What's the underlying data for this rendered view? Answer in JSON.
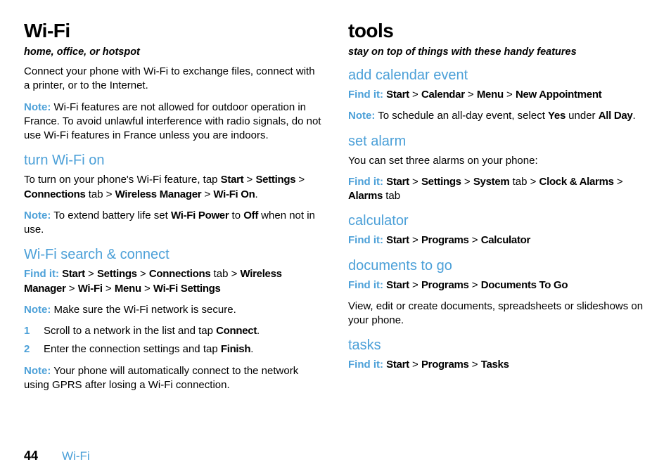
{
  "left": {
    "title": "Wi-Fi",
    "tagline": "home, office, or hotspot",
    "intro": "Connect your phone with Wi-Fi to exchange files, connect with a printer, or to the Internet.",
    "note1_label": "Note:",
    "note1_text": " Wi-Fi features are not allowed for outdoor operation in France. To avoid unlawful interference with radio signals, do not use Wi-Fi features in France unless you are indoors.",
    "s1": {
      "heading": "turn Wi-Fi on",
      "p_pre": "To turn on your phone's Wi-Fi feature, tap ",
      "pth1": "Start",
      "gt1": " > ",
      "pth2": "Settings",
      "gt2": " > ",
      "pth3": "Connections",
      "tab1": " tab > ",
      "pth4": "Wireless Manager",
      "gt3": " > ",
      "pth5": "Wi-Fi On",
      "dot1": ".",
      "note_label": "Note:",
      "note_pre": " To extend battery life set ",
      "note_b1": "Wi-Fi Power",
      "note_mid": " to ",
      "note_b2": "Off",
      "note_post": " when not in use."
    },
    "s2": {
      "heading": "Wi-Fi search & connect",
      "find_label": "Find it:",
      "sp": " ",
      "p1": "Start",
      "g1": " > ",
      "p2": "Settings",
      "g2": " > ",
      "p3": "Connections",
      "t1": " tab > ",
      "p4": "Wireless Manager",
      "g3": " > ",
      "p5": "Wi-Fi",
      "g4": " > ",
      "p6": "Menu",
      "g5": " > ",
      "p7": "Wi-Fi Settings",
      "note_label": "Note:",
      "note_text": " Make sure the Wi-Fi network is secure.",
      "step1_num": "1",
      "step1_pre": "Scroll to a network in the list and tap ",
      "step1_b": "Connect",
      "step1_post": ".",
      "step2_num": "2",
      "step2_pre": "Enter the connection settings and tap ",
      "step2_b": "Finish",
      "step2_post": ".",
      "note2_label": "Note:",
      "note2_text": " Your phone will automatically connect to the network using GPRS after losing a Wi-Fi connection."
    }
  },
  "right": {
    "title": "tools",
    "tagline": "stay on top of things with these handy features",
    "s1": {
      "heading": "add calendar event",
      "find_label": "Find it:",
      "sp": " ",
      "p1": "Start",
      "g1": " > ",
      "p2": "Calendar",
      "g2": " > ",
      "p3": "Menu",
      "g3": " > ",
      "p4": "New Appointment",
      "note_label": "Note:",
      "note_pre": " To schedule an all-day event, select ",
      "note_b1": "Yes",
      "note_mid": " under ",
      "note_b2": "All Day",
      "note_post": "."
    },
    "s2": {
      "heading": "set alarm",
      "intro": "You can set three alarms on your phone:",
      "find_label": "Find it:",
      "sp": "  ",
      "p1": "Start",
      "g1": " > ",
      "p2": "Settings",
      "g2": " > ",
      "p3": "System",
      "t1": " tab > ",
      "p4": "Clock & Alarms",
      "g3": " > ",
      "p5": "Alarms",
      "t2": " tab"
    },
    "s3": {
      "heading": "calculator",
      "find_label": "Find it:",
      "sp": "  ",
      "p1": "Start",
      "g1": " > ",
      "p2": "Programs",
      "g2": " > ",
      "p3": "Calculator"
    },
    "s4": {
      "heading": "documents to go",
      "find_label": "Find it:",
      "sp": "  ",
      "p1": "Start",
      "g1": " > ",
      "p2": "Programs",
      "g2": " > ",
      "p3": "Documents To Go",
      "desc": "View, edit or create documents, spreadsheets or slideshows on your phone."
    },
    "s5": {
      "heading": "tasks",
      "find_label": "Find it:",
      "sp": "  ",
      "p1": "Start",
      "g1": " > ",
      "p2": "Programs",
      "g2": " > ",
      "p3": "Tasks"
    }
  },
  "footer": {
    "page": "44",
    "section": "Wi-Fi"
  }
}
